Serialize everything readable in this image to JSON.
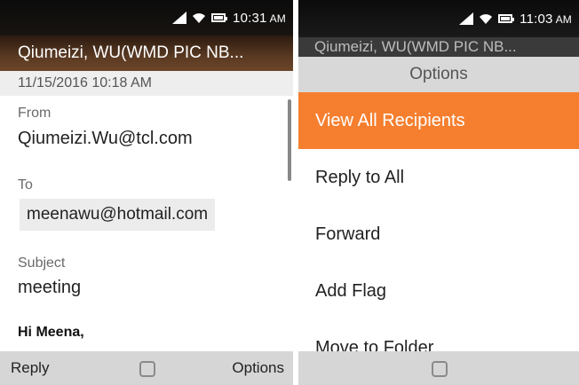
{
  "left": {
    "status_time": "10:31",
    "status_ampm": "AM",
    "title": "Qiumeizi, WU(WMD PIC NB...",
    "date": "11/15/2016 10:18 AM",
    "from_label": "From",
    "from_value": "Qiumeizi.Wu@tcl.com",
    "to_label": "To",
    "to_value": "meenawu@hotmail.com",
    "subject_label": "Subject",
    "subject_value": "meeting",
    "body_greeting": "Hi Meena,",
    "softkeys": {
      "left": "Reply",
      "right": "Options"
    }
  },
  "right": {
    "status_time": "11:03",
    "status_ampm": "AM",
    "background_title": "Qiumeizi, WU(WMD PIC NB...",
    "options_header": "Options",
    "items": [
      {
        "label": "View All Recipients",
        "selected": true
      },
      {
        "label": "Reply to All"
      },
      {
        "label": "Forward"
      },
      {
        "label": "Add Flag"
      },
      {
        "label": "Move to Folder"
      }
    ]
  },
  "colors": {
    "accent": "#f57f2f",
    "header_brown": "#5a3a22",
    "softkey_bg": "#d6d6d6"
  },
  "icons": [
    "signal-icon",
    "wifi-icon",
    "battery-icon",
    "center-select-icon"
  ]
}
